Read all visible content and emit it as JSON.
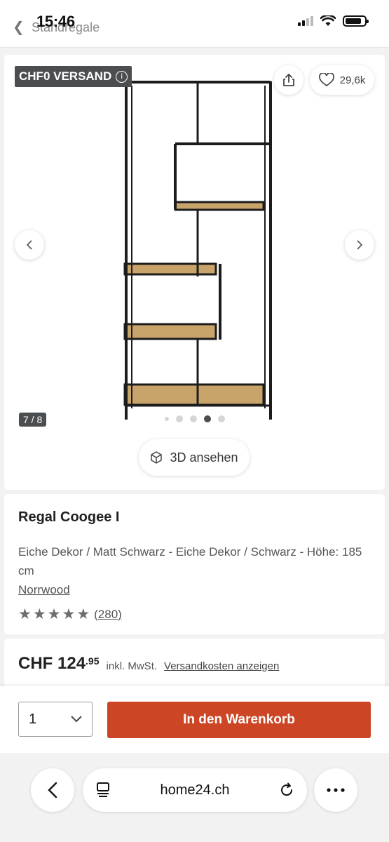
{
  "status_bar": {
    "time": "15:46"
  },
  "nav": {
    "breadcrumb": "Standregale"
  },
  "gallery": {
    "shipping_badge": "CHF0 VERSAND",
    "favorites_count": "29,6k",
    "image_counter": "7 / 8",
    "active_dot": 4,
    "view_3d_label": "3D ansehen",
    "icons": [
      "share-icon",
      "heart-icon",
      "chevron-left-icon",
      "chevron-right-icon",
      "cube-icon",
      "info-icon"
    ]
  },
  "product": {
    "title": "Regal Coogee I",
    "variant": "Eiche Dekor / Matt Schwarz - Eiche Dekor / Schwarz - Höhe: 185 cm",
    "brand": "Norrwood",
    "rating": 4.5,
    "reviews": "(280)"
  },
  "price": {
    "currency_main": "CHF 124",
    "cents": ".95",
    "vat_note": "inkl. MwSt.",
    "shipping_link": "Versandkosten anzeigen"
  },
  "cart": {
    "quantity": "1",
    "add_to_cart_label": "In den Warenkorb"
  },
  "browser": {
    "url": "home24.ch"
  },
  "colors": {
    "accent": "#cc4524",
    "badge": "#4b4e50",
    "wood": "#c9a46a",
    "frame": "#1c1c1c"
  }
}
